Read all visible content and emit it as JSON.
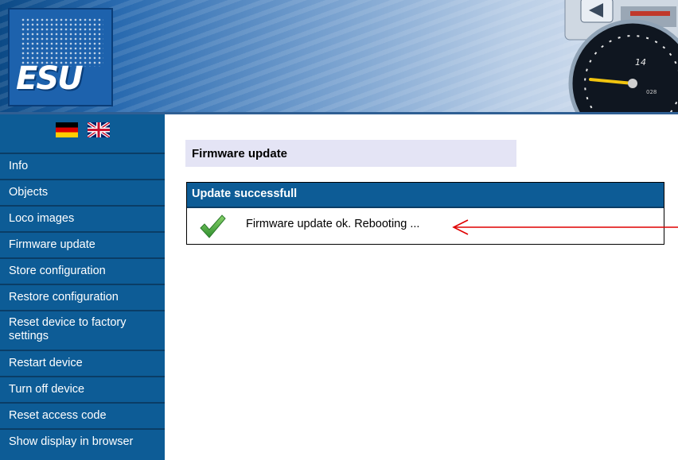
{
  "header": {
    "logo_text": "ESU",
    "gauge_numbers": [
      "14",
      "028"
    ]
  },
  "sidebar": {
    "flags": [
      "German flag",
      "UK flag"
    ],
    "items": [
      {
        "label": "Info"
      },
      {
        "label": "Objects"
      },
      {
        "label": "Loco images"
      },
      {
        "label": "Firmware update"
      },
      {
        "label": "Store configuration"
      },
      {
        "label": "Restore configuration"
      },
      {
        "label": "Reset device to factory settings"
      },
      {
        "label": "Restart device"
      },
      {
        "label": "Turn off device"
      },
      {
        "label": "Reset access code"
      },
      {
        "label": "Show display in browser"
      }
    ]
  },
  "main": {
    "page_title": "Firmware update",
    "result": {
      "header": "Update successfull",
      "icon": "check-icon",
      "message": "Firmware update ok. Rebooting ..."
    }
  },
  "colors": {
    "sidebar": "#0d5c96",
    "title_box": "#e4e4f5",
    "check": "#3aa63a",
    "annotation_arrow": "#e00000"
  }
}
